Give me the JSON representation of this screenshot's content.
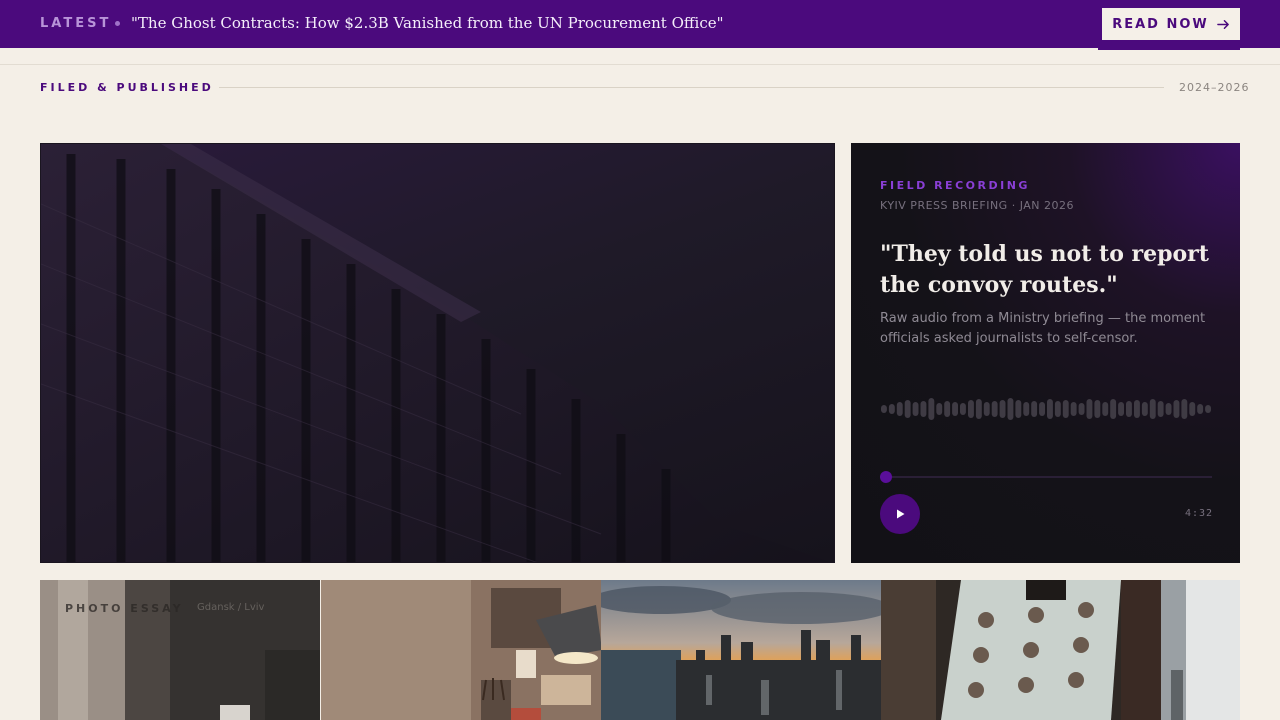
{
  "banner": {
    "latest_label": "LATEST",
    "headline": "\"The Ghost Contracts: How $2.3B Vanished from the UN Procurement Office\"",
    "read_now_label": "READ NOW",
    "read_now_icon": "arrow-right-icon"
  },
  "section": {
    "label": "FILED & PUBLISHED",
    "years": "2024–2026"
  },
  "audio": {
    "eyebrow": "FIELD RECORDING",
    "meta": "KYIV PRESS BRIEFING · JAN 2026",
    "quote": "\"They told us not to report the convoy routes.\"",
    "description": "Raw audio from a Ministry briefing — the moment officials asked journalists to self-censor.",
    "duration": "4:32",
    "progress": 0,
    "play_icon": "play-icon"
  },
  "photo_strip": {
    "label": "PHOTO ESSAY",
    "sublabel": "Gdansk / Lviv"
  },
  "colors": {
    "accent": "#4b0a7d",
    "background": "#f4efe7",
    "card": "#141218"
  }
}
